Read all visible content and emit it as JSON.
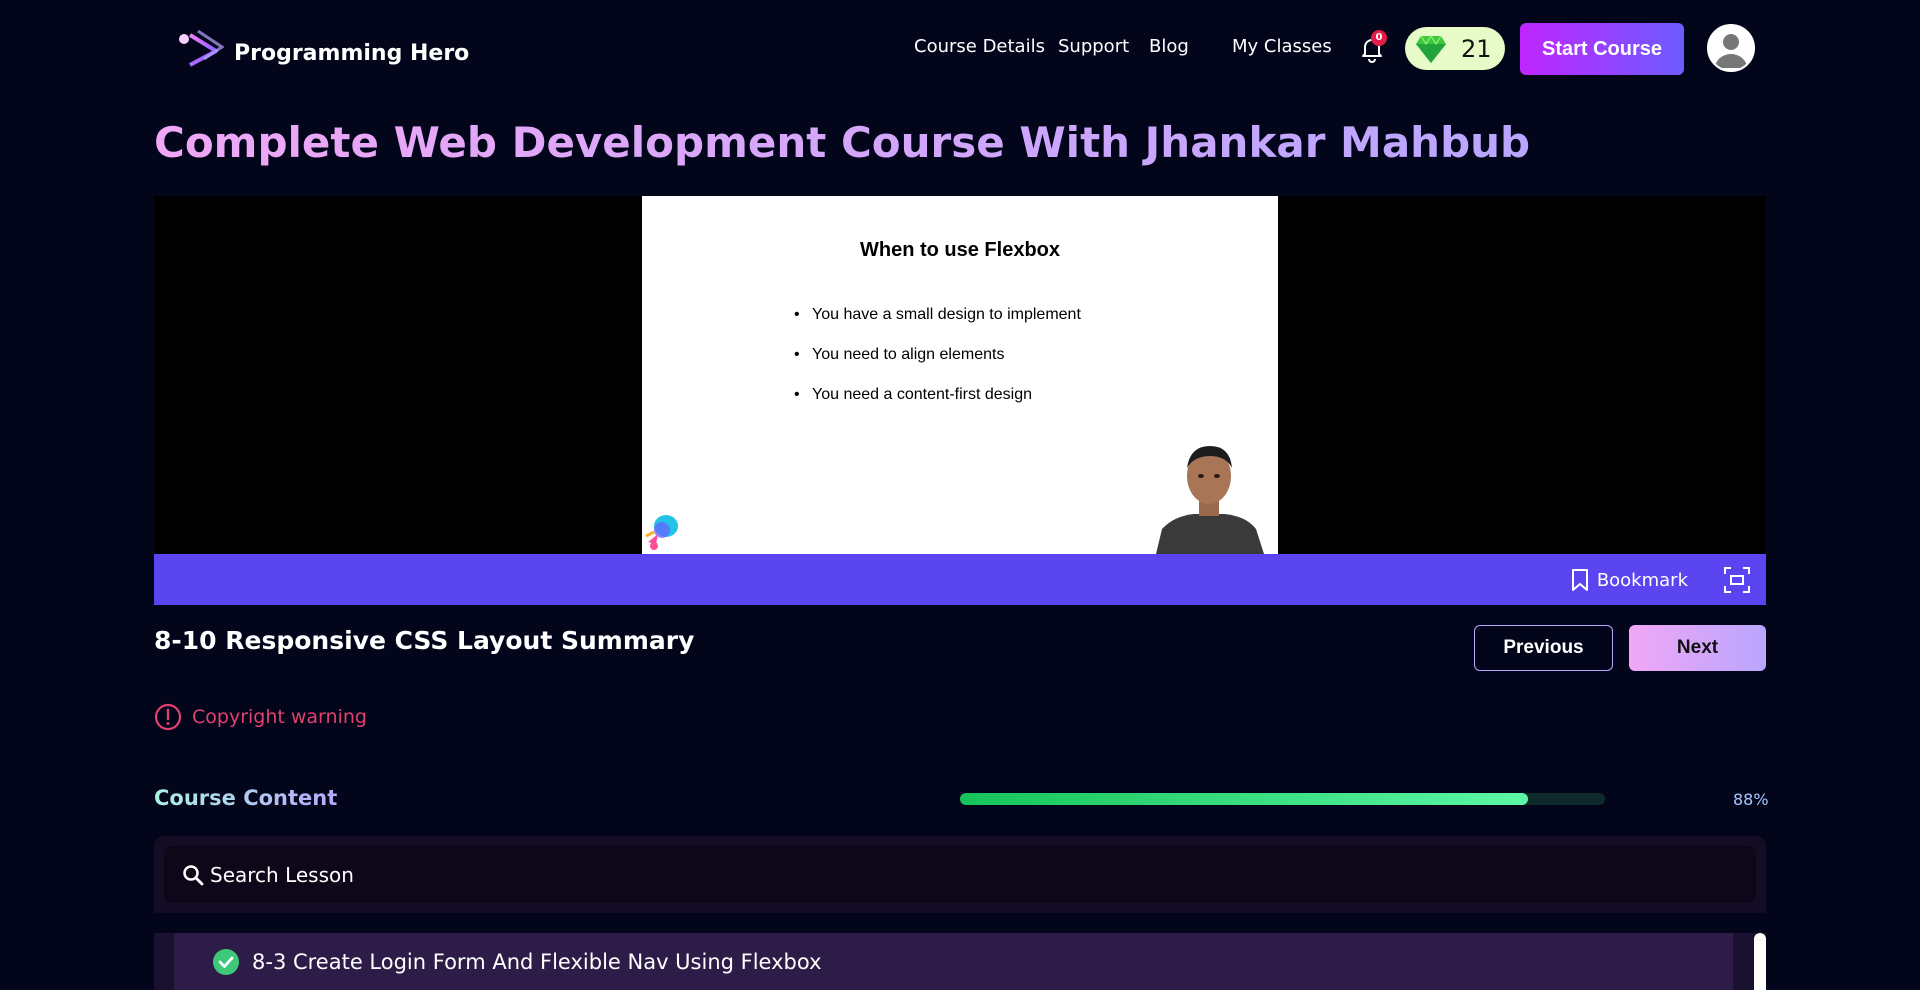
{
  "nav": {
    "brand": "Programming Hero",
    "links": [
      "Course Details",
      "Support",
      "Blog",
      "My Classes"
    ],
    "notification_count": "0",
    "gem_count": "21",
    "start_button": "Start Course"
  },
  "course": {
    "title": "Complete Web Development Course With Jhankar Mahbub"
  },
  "video": {
    "slide_title": "When to use Flexbox",
    "slide_points": [
      "You have a small design to implement",
      "You need to align elements",
      "You need a content-first design"
    ],
    "bookmark_label": "Bookmark"
  },
  "lesson": {
    "title": "8-10 Responsive CSS Layout Summary",
    "previous_label": "Previous",
    "next_label": "Next",
    "copyright_warning": "Copyright warning"
  },
  "course_content": {
    "title": "Course Content",
    "progress_percent": 88,
    "progress_label": "88%",
    "search_placeholder": "Search Lesson",
    "lessons": [
      {
        "label": "8-3 Create Login Form And Flexible Nav Using Flexbox",
        "completed": true
      }
    ]
  },
  "colors": {
    "background": "#03051a",
    "accent": "#5b45f0",
    "progress": "#16c45a",
    "warning": "#e0416f"
  }
}
